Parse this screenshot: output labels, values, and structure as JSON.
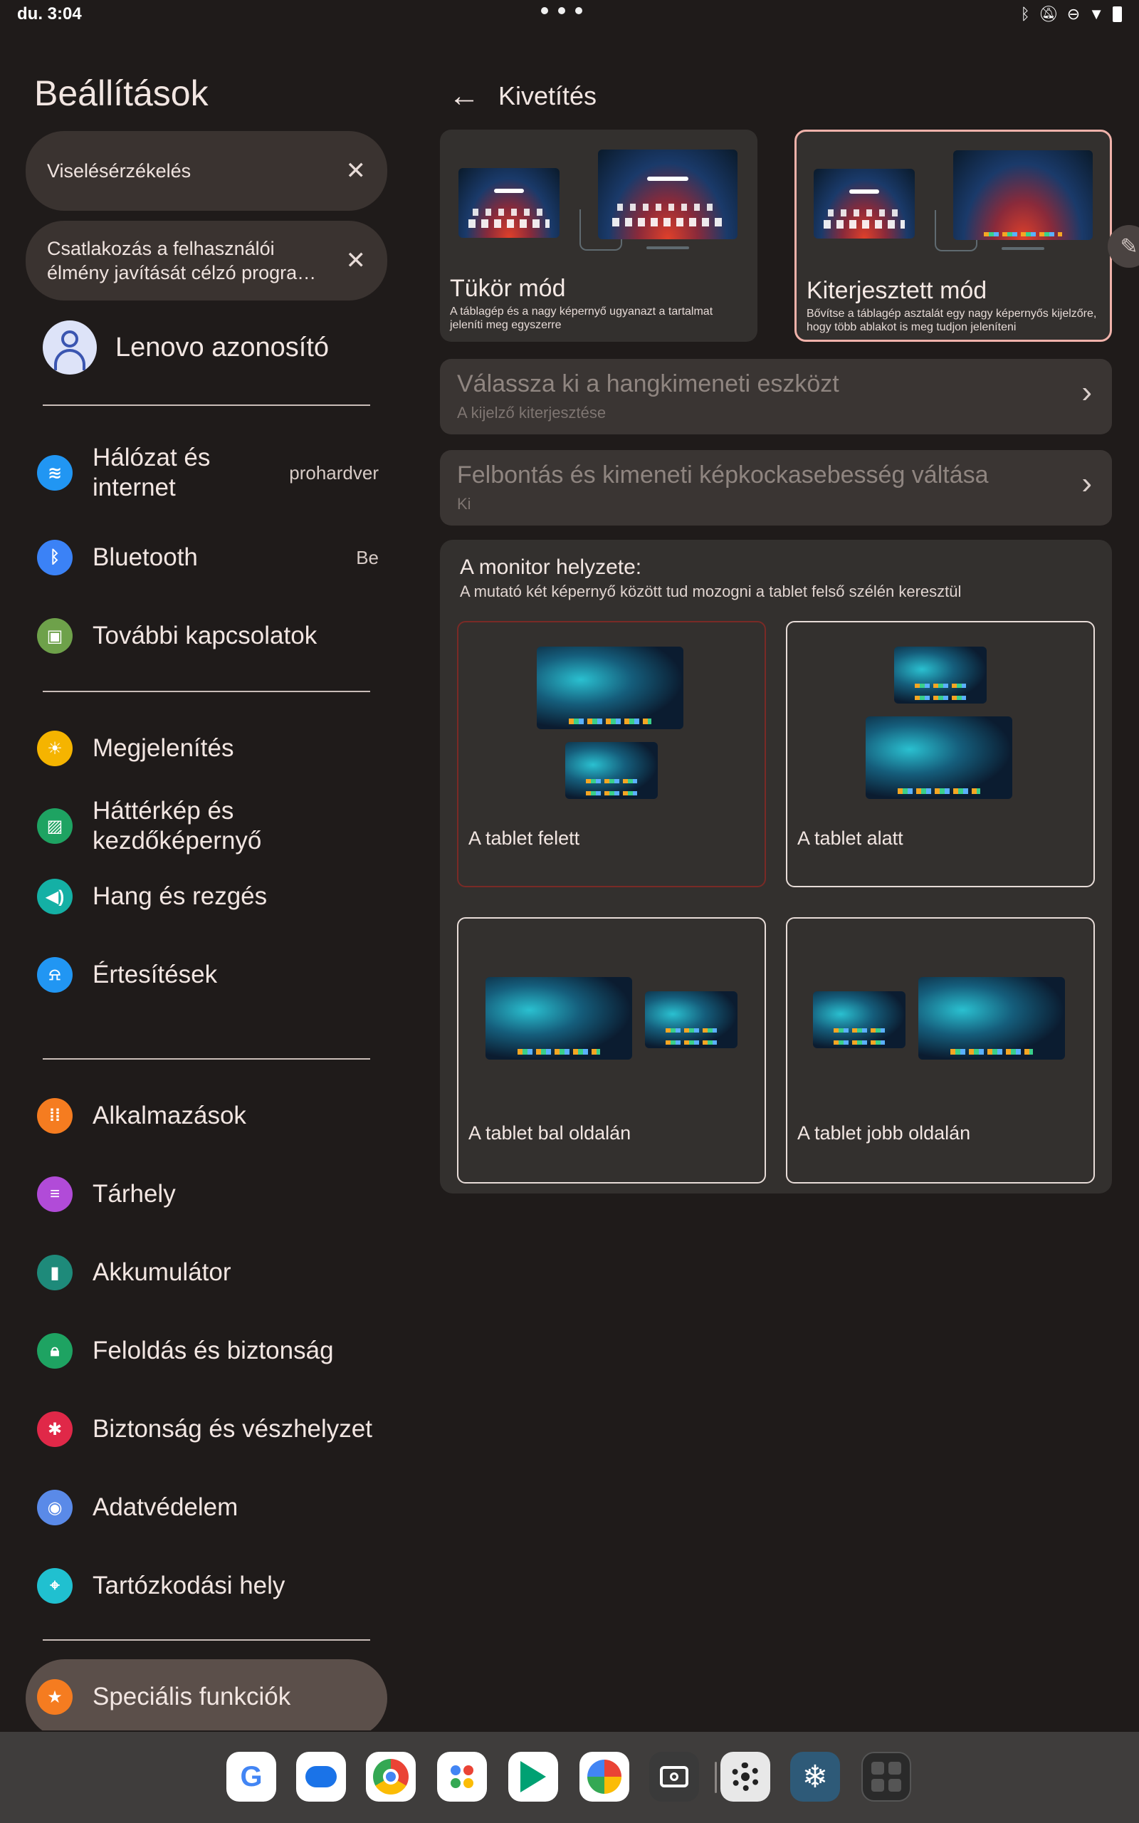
{
  "status_bar": {
    "time": "du. 3:04",
    "icons": [
      "bluetooth-icon",
      "notifications-off-icon",
      "dnd-icon",
      "wifi-icon",
      "battery-icon"
    ]
  },
  "settings": {
    "title": "Beállítások",
    "suggestions": [
      {
        "text": "Viselésérzékelés"
      },
      {
        "text": "Csatlakozás a felhasználói élmény javítását célzó progra…"
      }
    ],
    "account_label": "Lenovo azonosító",
    "items": [
      {
        "label": "Hálózat és internet",
        "value": "prohardver",
        "icon": "wifi-icon",
        "color": "#2196f3"
      },
      {
        "label": "Bluetooth",
        "value": "Be",
        "icon": "bluetooth-icon",
        "color": "#3b82f6"
      },
      {
        "label": "További kapcsolatok",
        "value": "",
        "icon": "devices-icon",
        "color": "#6ea14a"
      },
      {
        "label": "Megjelenítés",
        "value": "",
        "icon": "brightness-icon",
        "color": "#f5b400"
      },
      {
        "label": "Háttérkép és kezdőképernyő",
        "value": "",
        "icon": "wallpaper-icon",
        "color": "#1ea362"
      },
      {
        "label": "Hang és rezgés",
        "value": "",
        "icon": "volume-icon",
        "color": "#14b0a5"
      },
      {
        "label": "Értesítések",
        "value": "",
        "icon": "bell-icon",
        "color": "#2196f3"
      },
      {
        "label": "Alkalmazások",
        "value": "",
        "icon": "apps-icon",
        "color": "#f57c20"
      },
      {
        "label": "Tárhely",
        "value": "",
        "icon": "storage-icon",
        "color": "#b14bd8"
      },
      {
        "label": "Akkumulátor",
        "value": "",
        "icon": "battery-icon",
        "color": "#1e8a7a"
      },
      {
        "label": "Feloldás és biztonság",
        "value": "",
        "icon": "lock-icon",
        "color": "#1ea362"
      },
      {
        "label": "Biztonság és vészhelyzet",
        "value": "",
        "icon": "emergency-icon",
        "color": "#e02848"
      },
      {
        "label": "Adatvédelem",
        "value": "",
        "icon": "privacy-eye-icon",
        "color": "#5a8ae8"
      },
      {
        "label": "Tartózkodási hely",
        "value": "",
        "icon": "location-icon",
        "color": "#20c0d0"
      },
      {
        "label": "Speciális funkciók",
        "value": "",
        "icon": "star-icon",
        "color": "#f57c20"
      }
    ]
  },
  "projection": {
    "title": "Kivetítés",
    "modes": [
      {
        "title": "Tükör mód",
        "desc": "A táblagép és a nagy képernyő ugyanazt a tartalmat jeleníti meg egyszerre"
      },
      {
        "title": "Kiterjesztett mód",
        "desc": "Bővítse a táblagép asztalát egy nagy képernyős kijelzőre, hogy több ablakot is meg tudjon jeleníteni"
      }
    ],
    "audio": {
      "title": "Válassza ki a hangkimeneti eszközt",
      "subtitle": "A kijelző kiterjesztése"
    },
    "resolution": {
      "title": "Felbontás és kimeneti képkockasebesség váltása",
      "subtitle": "Ki"
    },
    "position": {
      "title": "A monitor helyzete:",
      "subtitle": "A mutató két képernyő között tud mozogni a tablet felső szélén keresztül",
      "options": [
        {
          "label": "A tablet felett"
        },
        {
          "label": "A tablet alatt"
        },
        {
          "label": "A tablet bal oldalán"
        },
        {
          "label": "A tablet jobb oldalán"
        }
      ]
    }
  },
  "taskbar": {
    "apps": [
      "google-icon",
      "messages-icon",
      "chrome-icon",
      "assistant-icon",
      "play-store-icon",
      "photos-icon",
      "camera-icon",
      "settings-icon",
      "snowflake-icon",
      "app-drawer-icon"
    ]
  }
}
